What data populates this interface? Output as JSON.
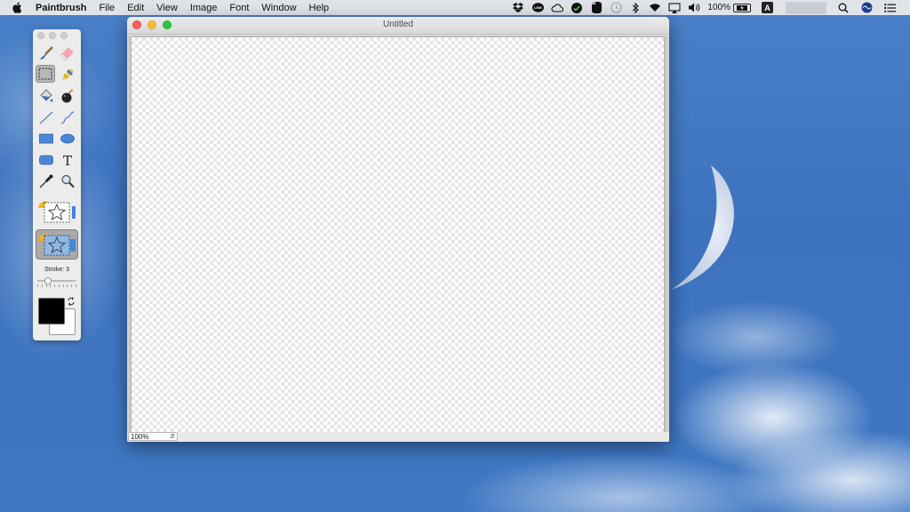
{
  "menubar": {
    "app_name": "Paintbrush",
    "menus": [
      "File",
      "Edit",
      "View",
      "Image",
      "Font",
      "Window",
      "Help"
    ],
    "battery_percent": "100%"
  },
  "window": {
    "title": "Untitled",
    "zoom": "100%"
  },
  "palette": {
    "stroke_label": "Stroke: 3",
    "stroke_value": 3,
    "tools": [
      "paintbrush-tool",
      "eraser-tool",
      "selection-tool",
      "eyedropper-fill-tool",
      "paint-bucket-tool",
      "spray-bomb-tool",
      "line-tool",
      "curve-tool",
      "rectangle-tool",
      "ellipse-tool",
      "rounded-rectangle-tool",
      "text-tool",
      "eyedropper-tool",
      "zoom-tool"
    ],
    "selected_tool": "selection-tool",
    "foreground_color": "#000000",
    "background_color": "#ffffff"
  },
  "colors": {
    "close": "#fc5f57",
    "minimize": "#fdbc2e",
    "maximize": "#28c840"
  }
}
